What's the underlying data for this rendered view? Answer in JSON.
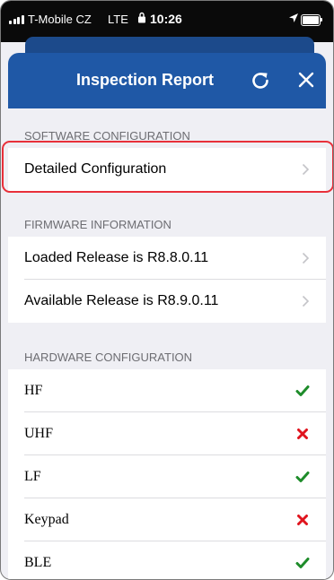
{
  "status_bar": {
    "carrier": "T-Mobile CZ",
    "network": "LTE",
    "time": "10:26"
  },
  "header": {
    "title": "Inspection Report",
    "refresh_icon": "refresh-icon",
    "close_icon": "close-icon",
    "color": "#1f58a6"
  },
  "sections": {
    "software": {
      "title": "SOFTWARE CONFIGURATION",
      "items": [
        {
          "label": "Detailed Configuration"
        }
      ]
    },
    "firmware": {
      "title": "FIRMWARE INFORMATION",
      "items": [
        {
          "label": "Loaded Release is R8.8.0.11"
        },
        {
          "label": "Available Release is R8.9.0.11"
        }
      ]
    },
    "hardware": {
      "title": "HARDWARE CONFIGURATION",
      "items": [
        {
          "label": "HF",
          "status": "check"
        },
        {
          "label": "UHF",
          "status": "cross"
        },
        {
          "label": "LF",
          "status": "check"
        },
        {
          "label": "Keypad",
          "status": "cross"
        },
        {
          "label": "BLE",
          "status": "check"
        }
      ]
    }
  },
  "colors": {
    "check": "#1e8c2a",
    "cross": "#e0141e",
    "highlight": "#e8303a"
  }
}
